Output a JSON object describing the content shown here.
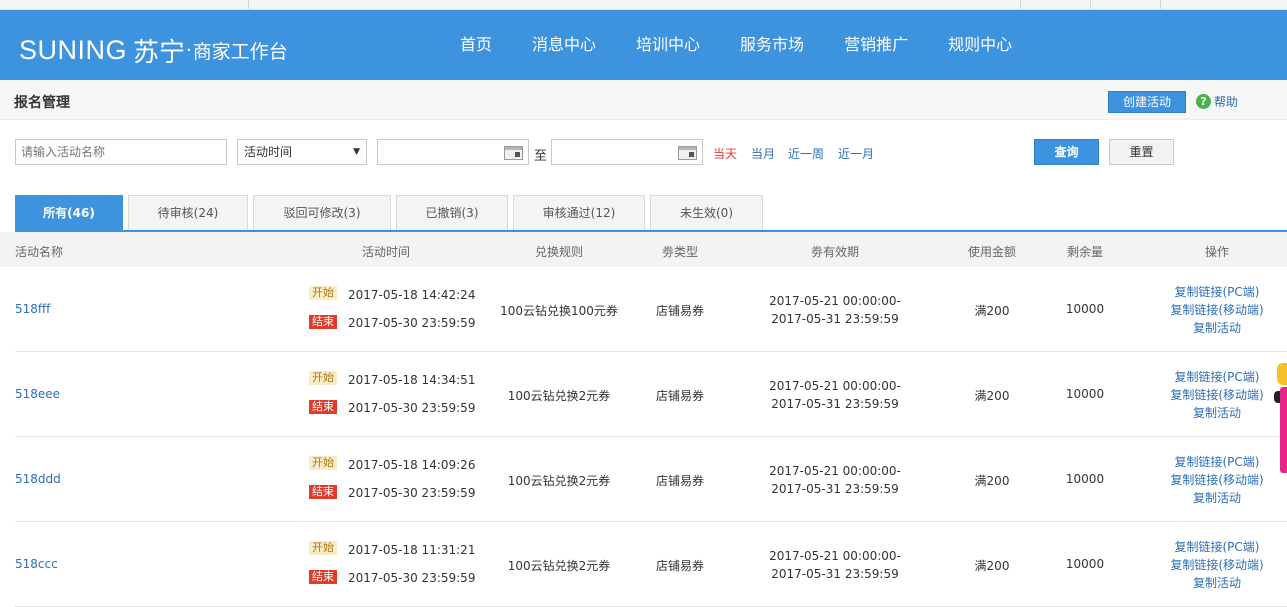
{
  "header": {
    "logo_en": "SUNING",
    "logo_cn": "苏宁",
    "logo_dot": "·",
    "logo_sub": "商家工作台",
    "nav": [
      "首页",
      "消息中心",
      "培训中心",
      "服务市场",
      "营销推广",
      "规则中心"
    ]
  },
  "titlebar": {
    "title": "报名管理",
    "create_label": "创建活动",
    "help_label": "帮助",
    "help_icon": "question-circle-icon"
  },
  "filters": {
    "name_placeholder": "请输入活动名称",
    "time_select": "活动时间",
    "to_label": "至",
    "quick": [
      "当天",
      "当月",
      "近一周",
      "近一月"
    ],
    "quick_active": "当天",
    "query_label": "查询",
    "reset_label": "重置"
  },
  "tabs": [
    {
      "label": "所有(46)",
      "active": true
    },
    {
      "label": "待审核(24)",
      "active": false
    },
    {
      "label": "驳回可修改(3)",
      "active": false
    },
    {
      "label": "已撤销(3)",
      "active": false
    },
    {
      "label": "审核通过(12)",
      "active": false
    },
    {
      "label": "未生效(0)",
      "active": false
    }
  ],
  "table": {
    "columns": [
      "活动名称",
      "活动时间",
      "兑换规则",
      "劵类型",
      "劵有效期",
      "使用金额",
      "剩余量",
      "操作"
    ],
    "start_badge": "开始",
    "end_badge": "结束",
    "rows": [
      {
        "name": "518fff",
        "start": "2017-05-18 14:42:24",
        "end": "2017-05-30 23:59:59",
        "rule": "100云钻兑换100元券",
        "type": "店铺易券",
        "valid_from": "2017-05-21 00:00:00-",
        "valid_to": "2017-05-31 23:59:59",
        "amount": "满200",
        "remain": "10000",
        "ops": [
          "复制链接(PC端)",
          "复制链接(移动端)",
          "复制活动"
        ]
      },
      {
        "name": "518eee",
        "start": "2017-05-18 14:34:51",
        "end": "2017-05-30 23:59:59",
        "rule": "100云钻兑换2元券",
        "type": "店铺易券",
        "valid_from": "2017-05-21 00:00:00-",
        "valid_to": "2017-05-31 23:59:59",
        "amount": "满200",
        "remain": "10000",
        "ops": [
          "复制链接(PC端)",
          "复制链接(移动端)",
          "复制活动"
        ]
      },
      {
        "name": "518ddd",
        "start": "2017-05-18 14:09:26",
        "end": "2017-05-30 23:59:59",
        "rule": "100云钻兑换2元券",
        "type": "店铺易券",
        "valid_from": "2017-05-21 00:00:00-",
        "valid_to": "2017-05-31 23:59:59",
        "amount": "满200",
        "remain": "10000",
        "ops": [
          "复制链接(PC端)",
          "复制链接(移动端)",
          "复制活动"
        ]
      },
      {
        "name": "518ccc",
        "start": "2017-05-18 11:31:21",
        "end": "2017-05-30 23:59:59",
        "rule": "100云钻兑换2元券",
        "type": "店铺易券",
        "valid_from": "2017-05-21 00:00:00-",
        "valid_to": "2017-05-31 23:59:59",
        "amount": "满200",
        "remain": "10000",
        "ops": [
          "复制链接(PC端)",
          "复制链接(移动端)",
          "复制活动"
        ]
      }
    ]
  },
  "colors": {
    "brand_blue": "#3e93de",
    "link_blue": "#2c6eb7",
    "end_badge_red": "#e03c2c",
    "start_badge_bg": "#faecc6",
    "side_pink": "#ea2487"
  }
}
